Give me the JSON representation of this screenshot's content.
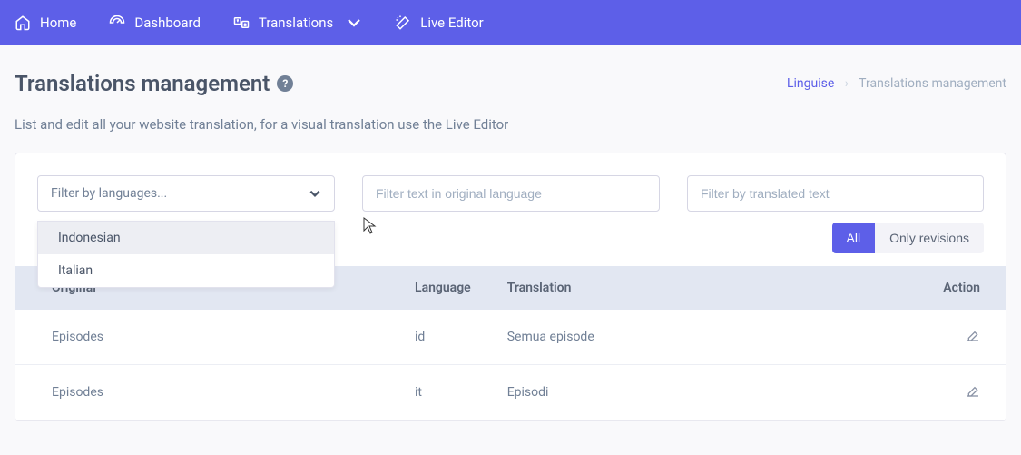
{
  "nav": {
    "home": "Home",
    "dashboard": "Dashboard",
    "translations": "Translations",
    "live_editor": "Live Editor"
  },
  "page": {
    "title": "Translations management",
    "description": "List and edit all your website translation, for a visual translation use the Live Editor"
  },
  "breadcrumb": {
    "root": "Linguise",
    "current": "Translations management"
  },
  "filters": {
    "language_placeholder": "Filter by languages...",
    "original_placeholder": "Filter text in original language",
    "translated_placeholder": "Filter by translated text",
    "dropdown": {
      "option1": "Indonesian",
      "option2": "Italian"
    }
  },
  "toggle": {
    "all": "All",
    "revisions": "Only revisions"
  },
  "table": {
    "headers": {
      "original": "Original",
      "language": "Language",
      "translation": "Translation",
      "action": "Action"
    },
    "rows": [
      {
        "original": "Episodes",
        "language": "id",
        "translation": "Semua episode"
      },
      {
        "original": "Episodes",
        "language": "it",
        "translation": "Episodi"
      }
    ]
  }
}
